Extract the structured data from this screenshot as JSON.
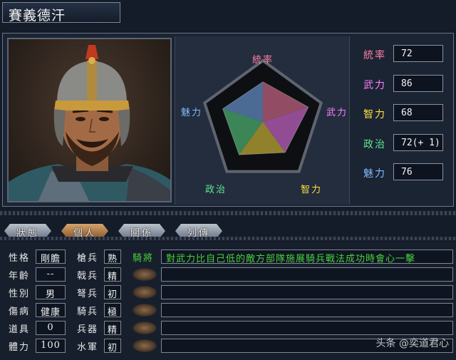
{
  "header": {
    "name": "賽義德汗"
  },
  "colors": {
    "tongshuai": "#ff7fa6",
    "wuli": "#ff7fff",
    "zhili": "#ffe040",
    "zhengzhi": "#60e890",
    "meili": "#80b8ff",
    "skill_green": "#49d13a"
  },
  "radar": {
    "labels": {
      "tongshuai": "統率",
      "wuli": "武力",
      "zhili": "智力",
      "zhengzhi": "政治",
      "meili": "魅力"
    },
    "max": 100
  },
  "stats": [
    {
      "key": "tongshuai",
      "label": "統率",
      "value": "72",
      "num": 72
    },
    {
      "key": "wuli",
      "label": "武力",
      "value": "86",
      "num": 86
    },
    {
      "key": "zhili",
      "label": "智力",
      "value": "68",
      "num": 68
    },
    {
      "key": "zhengzhi",
      "label": "政治",
      "value": "72(+ 1)",
      "num": 73
    },
    {
      "key": "meili",
      "label": "魅力",
      "value": "76",
      "num": 76
    }
  ],
  "tabs": [
    "狀態",
    "個人",
    "關係",
    "列傳"
  ],
  "personal": {
    "personality_label": "性格",
    "personality": "剛膽",
    "age_label": "年齡",
    "age": "--",
    "gender_label": "性別",
    "gender": "男",
    "health_label": "傷病",
    "health": "健康",
    "item_label": "道具",
    "item": "0",
    "stamina_label": "體力",
    "stamina": "100"
  },
  "aptitude": [
    {
      "label": "槍兵",
      "value": "熟"
    },
    {
      "label": "戟兵",
      "value": "精"
    },
    {
      "label": "弩兵",
      "value": "初"
    },
    {
      "label": "騎兵",
      "value": "極"
    },
    {
      "label": "兵器",
      "value": "精"
    },
    {
      "label": "水軍",
      "value": "初"
    }
  ],
  "skill": {
    "name": "騎將",
    "description": "對武力比自己低的敵方部隊施展騎兵戰法成功時會心一擊"
  },
  "watermark": "头条 @奕道君心"
}
